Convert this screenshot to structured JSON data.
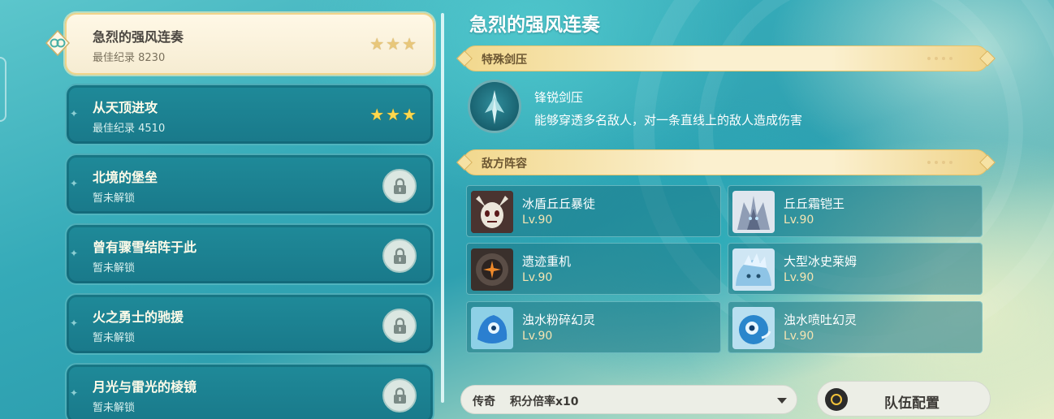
{
  "challenges": [
    {
      "title": "急烈的强风连奏",
      "sub": "最佳纪录 8230",
      "stars": 3,
      "locked": false,
      "active": true
    },
    {
      "title": "从天顶进攻",
      "sub": "最佳纪录 4510",
      "stars": 3,
      "locked": false,
      "active": false
    },
    {
      "title": "北境的堡垒",
      "sub": "暂未解锁",
      "stars": 0,
      "locked": true,
      "active": false
    },
    {
      "title": "曾有骤雪结阵于此",
      "sub": "暂未解锁",
      "stars": 0,
      "locked": true,
      "active": false
    },
    {
      "title": "火之勇士的驰援",
      "sub": "暂未解锁",
      "stars": 0,
      "locked": true,
      "active": false
    },
    {
      "title": "月光与雷光的棱镜",
      "sub": "暂未解锁",
      "stars": 0,
      "locked": true,
      "active": false
    }
  ],
  "detail": {
    "title": "急烈的强风连奏",
    "special_label": "特殊剑压",
    "skill": {
      "name": "锋锐剑压",
      "desc": "能够穿透多名敌人，对一条直线上的敌人造成伤害",
      "icon": "blade-pressure-icon"
    },
    "enemies_label": "敌方阵容",
    "enemies": [
      {
        "name": "冰盾丘丘暴徒",
        "level": "Lv.90",
        "portrait": "hilichurl-mask"
      },
      {
        "name": "丘丘霜铠王",
        "level": "Lv.90",
        "portrait": "frost-king"
      },
      {
        "name": "遗迹重机",
        "level": "Lv.90",
        "portrait": "ruin-machine"
      },
      {
        "name": "大型冰史莱姆",
        "level": "Lv.90",
        "portrait": "ice-slime"
      },
      {
        "name": "浊水粉碎幻灵",
        "level": "Lv.90",
        "portrait": "water-phantasm"
      },
      {
        "name": "浊水喷吐幻灵",
        "level": "Lv.90",
        "portrait": "water-phantasm-2"
      }
    ]
  },
  "difficulty": {
    "label": "传奇",
    "value": "积分倍率x10"
  },
  "team_button": "队伍配置",
  "colors": {
    "accent_gold": "#f2d88e",
    "panel_teal": "#1f8a99",
    "star": "#ffd84d"
  }
}
